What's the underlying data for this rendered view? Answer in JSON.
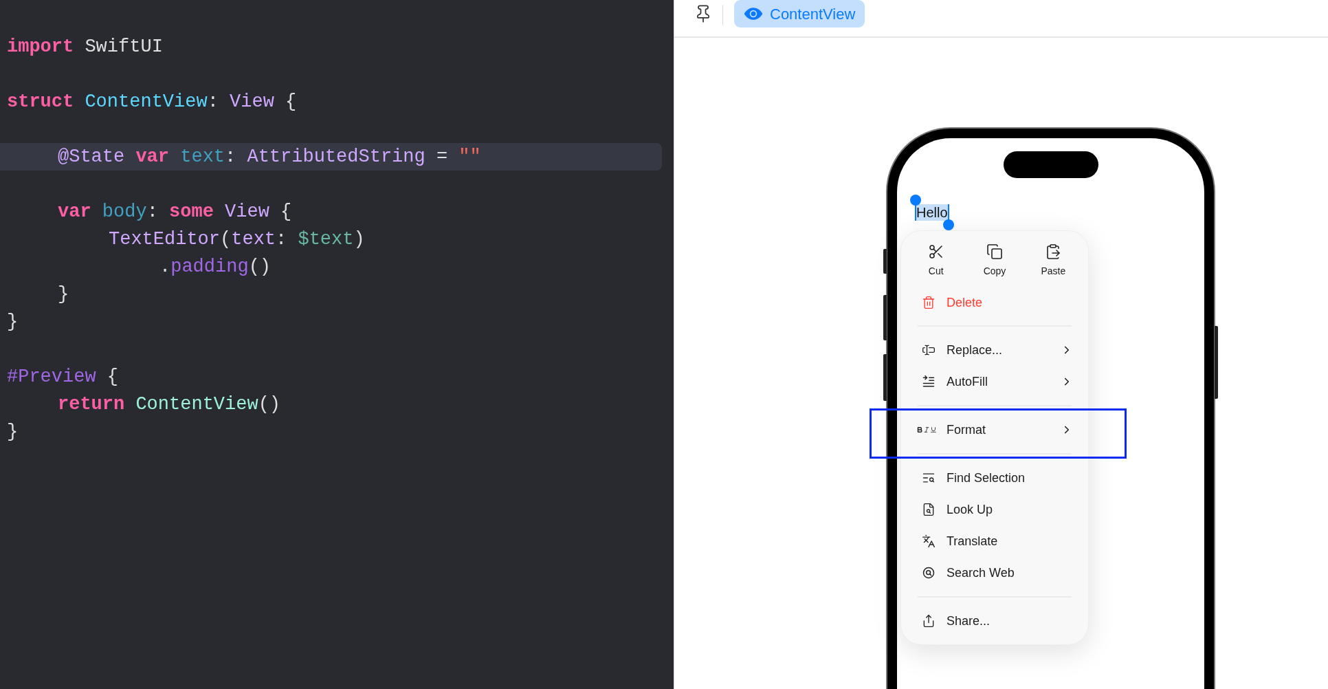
{
  "editor": {
    "lines": [
      {
        "kind": "code",
        "highlighted": false,
        "tokens": [
          {
            "text": "import ",
            "kind": "keyword"
          },
          {
            "text": "SwiftUI",
            "kind": "plain"
          }
        ]
      },
      {
        "kind": "blank",
        "highlighted": false
      },
      {
        "kind": "code",
        "highlighted": false,
        "tokens": [
          {
            "text": "struct ",
            "kind": "keyword"
          },
          {
            "text": "ContentView",
            "kind": "type_decl"
          },
          {
            "text": ": ",
            "kind": "plain"
          },
          {
            "text": "View",
            "kind": "type"
          },
          {
            "text": " {",
            "kind": "plain"
          }
        ],
        "children": [
          {
            "kind": "blank",
            "highlighted": false
          },
          {
            "kind": "code",
            "highlighted": true,
            "tokens": [
              {
                "text": "@State ",
                "kind": "type"
              },
              {
                "text": "var ",
                "kind": "keyword"
              },
              {
                "text": "text",
                "kind": "property"
              },
              {
                "text": ": ",
                "kind": "plain"
              },
              {
                "text": "AttributedString",
                "kind": "type"
              },
              {
                "text": " = ",
                "kind": "plain"
              },
              {
                "text": "\"\"",
                "kind": "string"
              }
            ]
          },
          {
            "kind": "blank",
            "highlighted": false
          },
          {
            "kind": "code",
            "highlighted": false,
            "tokens": [
              {
                "text": "var ",
                "kind": "keyword"
              },
              {
                "text": "body",
                "kind": "property"
              },
              {
                "text": ": ",
                "kind": "plain"
              },
              {
                "text": "some ",
                "kind": "keyword"
              },
              {
                "text": "View",
                "kind": "type"
              },
              {
                "text": " {",
                "kind": "plain"
              }
            ],
            "children": [
              {
                "kind": "code",
                "highlighted": false,
                "tokens": [
                  {
                    "text": "TextEditor",
                    "kind": "type"
                  },
                  {
                    "text": "(",
                    "kind": "plain"
                  },
                  {
                    "text": "text",
                    "kind": "type"
                  },
                  {
                    "text": ": ",
                    "kind": "plain"
                  },
                  {
                    "text": "$text",
                    "kind": "variable"
                  },
                  {
                    "text": ")",
                    "kind": "plain"
                  }
                ],
                "children": [
                  {
                    "kind": "code",
                    "highlighted": false,
                    "tokens": [
                      {
                        "text": ".",
                        "kind": "plain"
                      },
                      {
                        "text": "padding",
                        "kind": "method"
                      },
                      {
                        "text": "()",
                        "kind": "plain"
                      }
                    ]
                  }
                ]
              }
            ]
          },
          {
            "kind": "code",
            "highlighted": false,
            "tokens": [
              {
                "text": "}",
                "kind": "plain"
              }
            ]
          }
        ]
      },
      {
        "kind": "code",
        "highlighted": false,
        "tokens": [
          {
            "text": "}",
            "kind": "plain"
          }
        ]
      },
      {
        "kind": "blank",
        "highlighted": false
      },
      {
        "kind": "code",
        "highlighted": false,
        "tokens": [
          {
            "text": "#Preview",
            "kind": "macro"
          },
          {
            "text": " {",
            "kind": "plain"
          }
        ],
        "children": [
          {
            "kind": "code",
            "highlighted": false,
            "tokens": [
              {
                "text": "return ",
                "kind": "keyword"
              },
              {
                "text": "ContentView",
                "kind": "class_ref"
              },
              {
                "text": "()",
                "kind": "plain"
              }
            ]
          }
        ]
      },
      {
        "kind": "code",
        "highlighted": false,
        "tokens": [
          {
            "text": "}",
            "kind": "plain"
          }
        ]
      }
    ]
  },
  "preview": {
    "toolbar": {
      "tabs": [
        {
          "label": "ContentView",
          "selected": true
        }
      ]
    },
    "text_editor": {
      "text": "Hello",
      "selected": true
    },
    "menu": {
      "edit_actions": [
        {
          "label": "Cut"
        },
        {
          "label": "Copy"
        },
        {
          "label": "Paste"
        }
      ],
      "sections": [
        {
          "items": [
            {
              "label": "Delete",
              "kind": "destructive",
              "submenu": false,
              "highlighted": false
            }
          ]
        },
        {
          "items": [
            {
              "label": "Replace...",
              "kind": "normal",
              "submenu": true,
              "highlighted": false
            },
            {
              "label": "AutoFill",
              "kind": "normal",
              "submenu": true,
              "highlighted": false
            }
          ]
        },
        {
          "items": [
            {
              "label": "Format",
              "kind": "normal",
              "submenu": true,
              "highlighted": true
            }
          ]
        },
        {
          "items": [
            {
              "label": "Find Selection",
              "kind": "normal",
              "submenu": false,
              "highlighted": false
            },
            {
              "label": "Look Up",
              "kind": "normal",
              "submenu": false,
              "highlighted": false
            },
            {
              "label": "Translate",
              "kind": "normal",
              "submenu": false,
              "highlighted": false
            },
            {
              "label": "Search Web",
              "kind": "normal",
              "submenu": false,
              "highlighted": false
            }
          ]
        },
        {
          "items": [
            {
              "label": "Share...",
              "kind": "normal",
              "submenu": false,
              "highlighted": false
            }
          ]
        }
      ]
    }
  }
}
